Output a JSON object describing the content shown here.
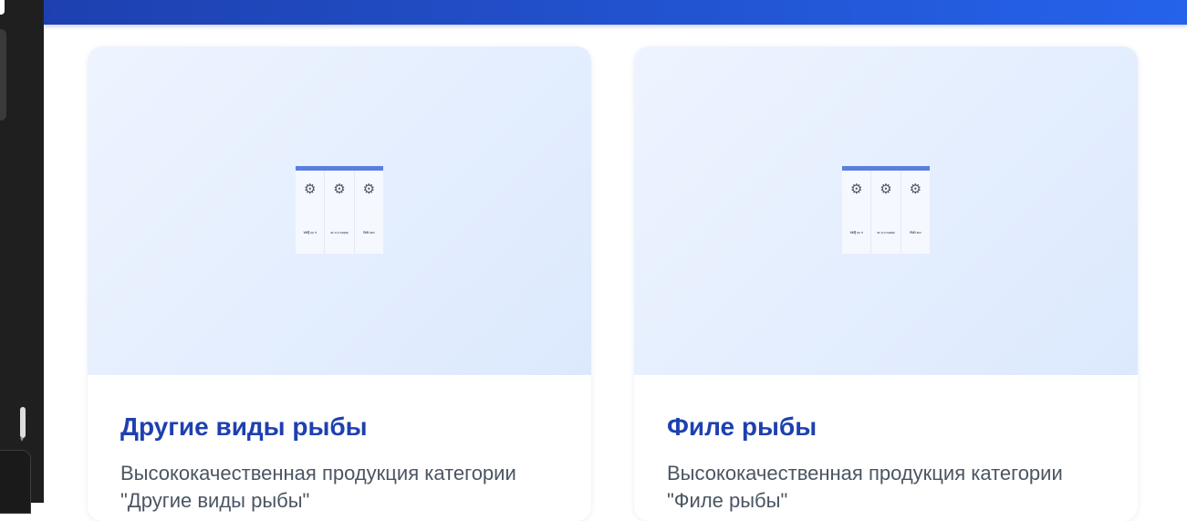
{
  "cards": [
    {
      "title": "Другие виды рыбы",
      "description": "Высококачественная продукция категории \"Другие виды рыбы\"",
      "thumbnail": {
        "icon": "gear-icon",
        "columns": [
          "ᵂᴹ̂Ĭ ᵖᵖ ʳᵗ",
          "ᵃᶜ ᵃ ᵖ ʳᵘᵖᵖᵉʸ",
          "ᴿᴹᴺ ᵃᶜᵒ"
        ]
      }
    },
    {
      "title": "Филе рыбы",
      "description": "Высококачественная продукция категории \"Филе рыбы\"",
      "thumbnail": {
        "icon": "gear-icon",
        "columns": [
          "ᵂᴹ̂Ĭ ᵖᵖ ʳᵗ",
          "ᵃᶜ ᵃ ᵖ ʳᵘᵖᵖᵉʸ",
          "ᴿᴹᴺ ᵃᶜᵒ"
        ]
      }
    }
  ],
  "colors": {
    "header_gradient_start": "#1e40af",
    "header_gradient_end": "#2563eb",
    "title": "#1e40af",
    "description": "#4b5563",
    "image_bg": "#e4eefd"
  }
}
